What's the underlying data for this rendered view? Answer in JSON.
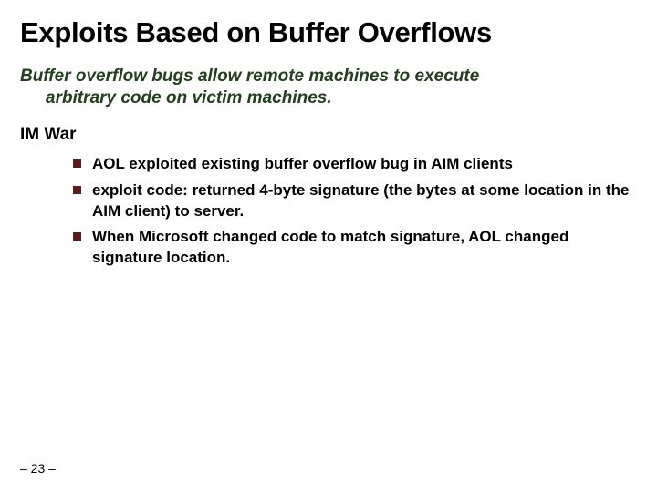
{
  "title": "Exploits Based on Buffer Overflows",
  "subtitle_line1": "Buffer overflow bugs allow remote machines to execute",
  "subtitle_line2": "arbitrary code on victim machines.",
  "section_heading": "IM War",
  "bullets": [
    "AOL exploited existing buffer overflow bug in AIM clients",
    "exploit code: returned 4-byte signature (the bytes at some location in the AIM client) to server.",
    "When Microsoft changed code to match signature, AOL changed signature location."
  ],
  "page_number": "– 23 –"
}
